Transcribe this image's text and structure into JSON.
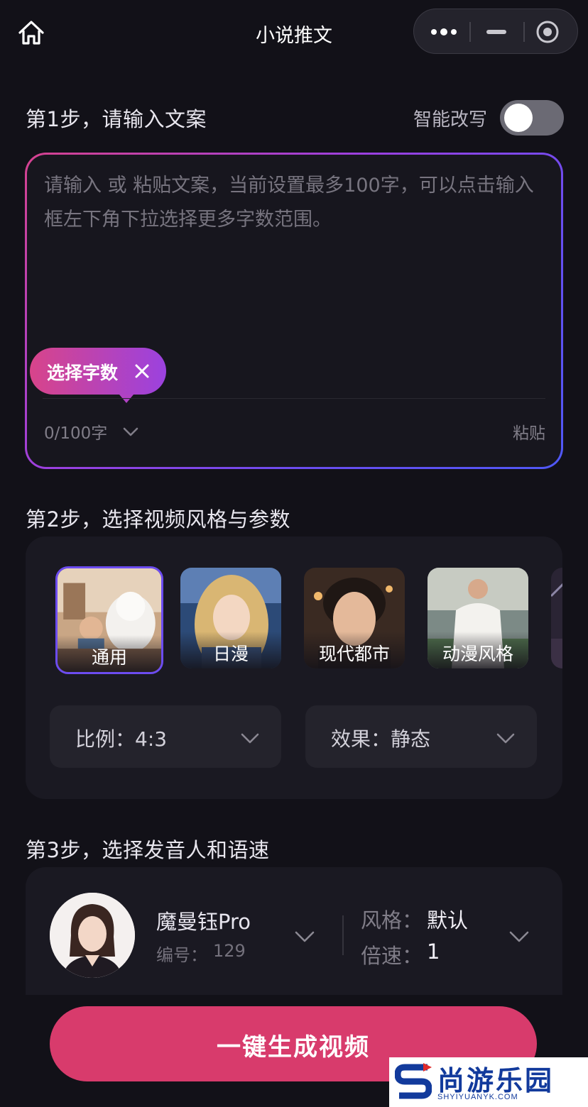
{
  "header": {
    "title": "小说推文"
  },
  "step1": {
    "title": "第1步，请输入文案",
    "smart_rewrite_label": "智能改写",
    "smart_rewrite_on": false,
    "placeholder": "请输入 或 粘贴文案，当前设置最多100字，可以点击输入框左下角下拉选择更多字数范围。",
    "chip_label": "选择字数",
    "counter": "0/100字",
    "paste_label": "粘贴"
  },
  "step2": {
    "title": "第2步，选择视频风格与参数",
    "styles": [
      {
        "label": "通用",
        "selected": true
      },
      {
        "label": "日漫",
        "selected": false
      },
      {
        "label": "现代都市",
        "selected": false
      },
      {
        "label": "动漫风格",
        "selected": false
      }
    ],
    "ratio_label": "比例：",
    "ratio_value": "4:3",
    "effect_label": "效果：",
    "effect_value": "静态"
  },
  "step3": {
    "title": "第3步，选择发音人和语速",
    "voice_name": "魔曼钰Pro",
    "voice_id_label": "编号：",
    "voice_id": "129",
    "style_label": "风格：",
    "style_value": "默认",
    "speed_label": "倍速：",
    "speed_value": "1"
  },
  "generate_button": "一键生成视频",
  "watermark": {
    "brand": "尚游乐园",
    "url": "SHYIYUANYK.COM"
  },
  "colors": {
    "accent": "#d83b6c",
    "select_border": "#6c4cf0",
    "background": "#121118"
  }
}
